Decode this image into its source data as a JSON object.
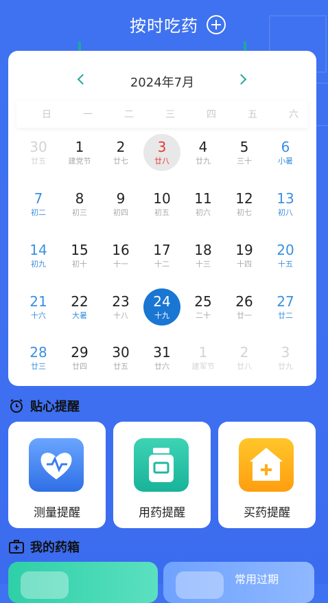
{
  "header": {
    "title": "按时吃药",
    "add_icon": "plus-circle-icon"
  },
  "calendar": {
    "month_label": "2024年7月",
    "prev_icon": "chevron-left-icon",
    "next_icon": "chevron-right-icon",
    "weekdays": [
      "日",
      "一",
      "二",
      "三",
      "四",
      "五",
      "六"
    ],
    "days": [
      {
        "num": "30",
        "sub": "廿五"
      },
      {
        "num": "1",
        "sub": "建党节"
      },
      {
        "num": "2",
        "sub": "廿七"
      },
      {
        "num": "3",
        "sub": "廿八"
      },
      {
        "num": "4",
        "sub": "廿九"
      },
      {
        "num": "5",
        "sub": "三十"
      },
      {
        "num": "6",
        "sub": "小暑"
      },
      {
        "num": "7",
        "sub": "初二"
      },
      {
        "num": "8",
        "sub": "初三"
      },
      {
        "num": "9",
        "sub": "初四"
      },
      {
        "num": "10",
        "sub": "初五"
      },
      {
        "num": "11",
        "sub": "初六"
      },
      {
        "num": "12",
        "sub": "初七"
      },
      {
        "num": "13",
        "sub": "初八"
      },
      {
        "num": "14",
        "sub": "初九"
      },
      {
        "num": "15",
        "sub": "初十"
      },
      {
        "num": "16",
        "sub": "十一"
      },
      {
        "num": "17",
        "sub": "十二"
      },
      {
        "num": "18",
        "sub": "十三"
      },
      {
        "num": "19",
        "sub": "十四"
      },
      {
        "num": "20",
        "sub": "十五"
      },
      {
        "num": "21",
        "sub": "十六"
      },
      {
        "num": "22",
        "sub": "大暑"
      },
      {
        "num": "23",
        "sub": "十八"
      },
      {
        "num": "24",
        "sub": "十九"
      },
      {
        "num": "25",
        "sub": "二十"
      },
      {
        "num": "26",
        "sub": "廿一"
      },
      {
        "num": "27",
        "sub": "廿二"
      },
      {
        "num": "28",
        "sub": "廿三"
      },
      {
        "num": "29",
        "sub": "廿四"
      },
      {
        "num": "30",
        "sub": "廿五"
      },
      {
        "num": "31",
        "sub": "廿六"
      },
      {
        "num": "1",
        "sub": "建军节"
      },
      {
        "num": "2",
        "sub": "廿八"
      },
      {
        "num": "3",
        "sub": "廿九"
      }
    ]
  },
  "reminders": {
    "title": "贴心提醒",
    "icon": "alarm-clock-icon",
    "items": [
      {
        "label": "测量提醒",
        "icon": "heart-pulse-icon"
      },
      {
        "label": "用药提醒",
        "icon": "medicine-bottle-icon"
      },
      {
        "label": "买药提醒",
        "icon": "house-plus-icon"
      }
    ]
  },
  "medicine_box": {
    "title": "我的药箱",
    "icon": "medical-kit-icon",
    "partial_text": "常用过期"
  },
  "colors": {
    "background": "#3f72f0",
    "accent_teal": "#1aa9a0",
    "selected_blue": "#1976d2",
    "today_red": "#e53935",
    "weekend_blue": "#3b8fe0"
  }
}
